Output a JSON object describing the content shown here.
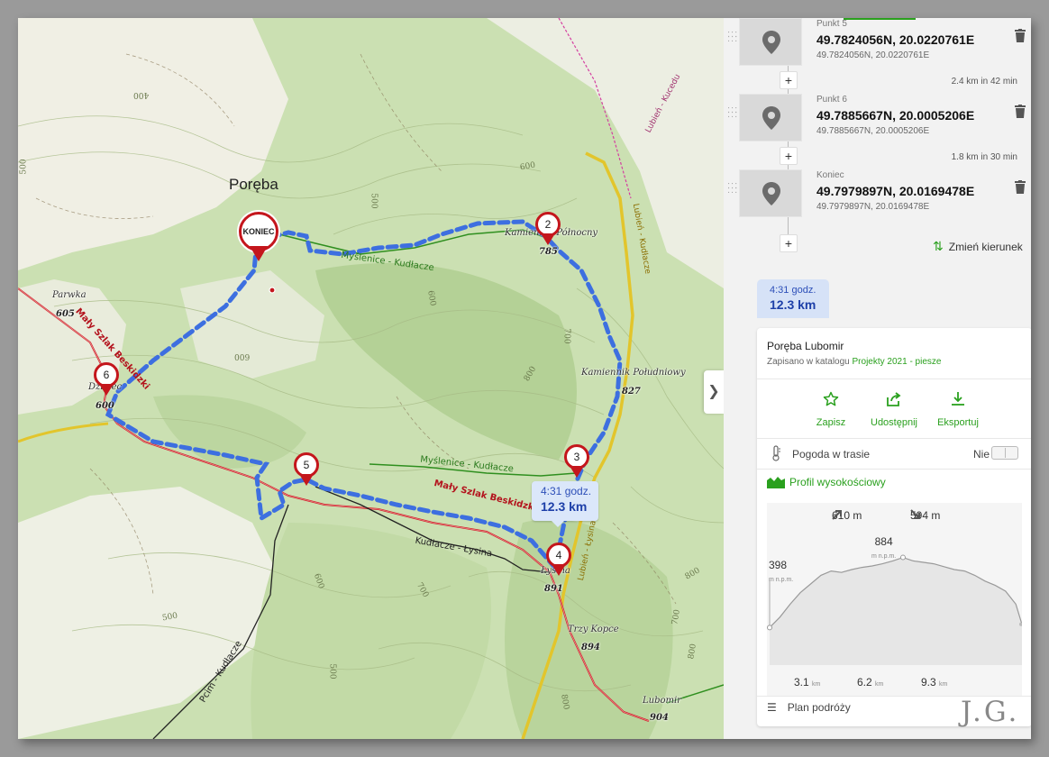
{
  "map": {
    "place_label": "Poręba",
    "peaks": [
      {
        "name": "Kamiennik Północny",
        "elevation": "785"
      },
      {
        "name": "Kamiennik Południowy",
        "elevation": "827"
      },
      {
        "name": "Parwka",
        "elevation": "605"
      },
      {
        "name": "Dzielec",
        "elevation": "600"
      },
      {
        "name": "Łysina",
        "elevation": "891"
      },
      {
        "name": "Trzy Kopce",
        "elevation": "894"
      },
      {
        "name": "Lubomir",
        "elevation": "904"
      }
    ],
    "contour_labels": [
      "400",
      "500",
      "500",
      "600",
      "700",
      "600",
      "800",
      "600",
      "700",
      "600",
      "500",
      "800",
      "700",
      "800",
      "500",
      "800"
    ],
    "trails": {
      "green_north": "Myślenice - Kudłacze",
      "green_south": "Myślenice - Kudłacze",
      "red": "Mały Szlak Beskidzki",
      "red_west": "Mały Szlak Beskidzki",
      "black": "Kudłacze - Łysina",
      "black_sw": "Pcim - Kudłacze",
      "yellow_a": "Lubień - Kudłacze",
      "yellow_b": "Lubień - Łysina",
      "pink": "Lubień - Kucedu"
    },
    "markers": [
      {
        "label": "KONIEC"
      },
      {
        "label": "2"
      },
      {
        "label": "3"
      },
      {
        "label": "4"
      },
      {
        "label": "5"
      },
      {
        "label": "6"
      }
    ],
    "tooltip": {
      "time": "4:31 godz.",
      "distance": "12.3 km"
    },
    "collapse_icon": "chevron-right-icon",
    "colors": {
      "route": "#3d6fe0",
      "marker": "#c4161c",
      "red_trail": "#d2232a",
      "green_trail": "#2f8f1f",
      "yellow_road": "#e8d231"
    }
  },
  "panel": {
    "waypoints": [
      {
        "label": "Punkt 5",
        "coords": "49.7824056N, 20.0220761E",
        "sub": "49.7824056N, 20.0220761E"
      },
      {
        "label": "Punkt 6",
        "coords": "49.7885667N, 20.0005206E",
        "sub": "49.7885667N, 20.0005206E"
      },
      {
        "label": "Koniec",
        "coords": "49.7979897N, 20.0169478E",
        "sub": "49.7979897N, 20.0169478E"
      }
    ],
    "segments": [
      "2.4 km in 42 min",
      "1.8 km in 30 min"
    ],
    "add_label": "+",
    "reverse_label": "Zmień kierunek",
    "summary": {
      "time": "4:31 godz.",
      "distance": "12.3 km"
    },
    "route": {
      "name": "Poręba Lubomir",
      "saved_prefix": "Zapisano w katalogu",
      "catalog": "Projekty 2021 - piesze"
    },
    "actions": [
      {
        "label": "Zapisz",
        "icon": "star-icon"
      },
      {
        "label": "Udostępnij",
        "icon": "share-icon"
      },
      {
        "label": "Eksportuj",
        "icon": "download-icon"
      }
    ],
    "weather": {
      "label": "Pogoda w trasie",
      "toggle_value": "Nie"
    },
    "profile": {
      "title": "Profil wysokościowy",
      "ascent": "610 m",
      "descent": "594 m",
      "start_elev": "398",
      "max_elev": "884",
      "unit": "m n.p.m.",
      "x_ticks": [
        "3.1",
        "6.2",
        "9.3"
      ],
      "x_unit": "km",
      "elevation_km": [
        0,
        0.5,
        1,
        1.5,
        2,
        2.5,
        3,
        3.5,
        4,
        4.5,
        5,
        5.5,
        6,
        6.5,
        7,
        7.5,
        8,
        8.5,
        9,
        9.5,
        10,
        10.5,
        11,
        11.5,
        12,
        12.3
      ],
      "elevation_m": [
        398,
        470,
        560,
        640,
        700,
        760,
        790,
        780,
        800,
        815,
        825,
        840,
        860,
        884,
        860,
        850,
        840,
        820,
        800,
        790,
        760,
        720,
        690,
        650,
        560,
        420
      ]
    },
    "plan_label": "Plan podróży"
  },
  "signature": "J.G."
}
